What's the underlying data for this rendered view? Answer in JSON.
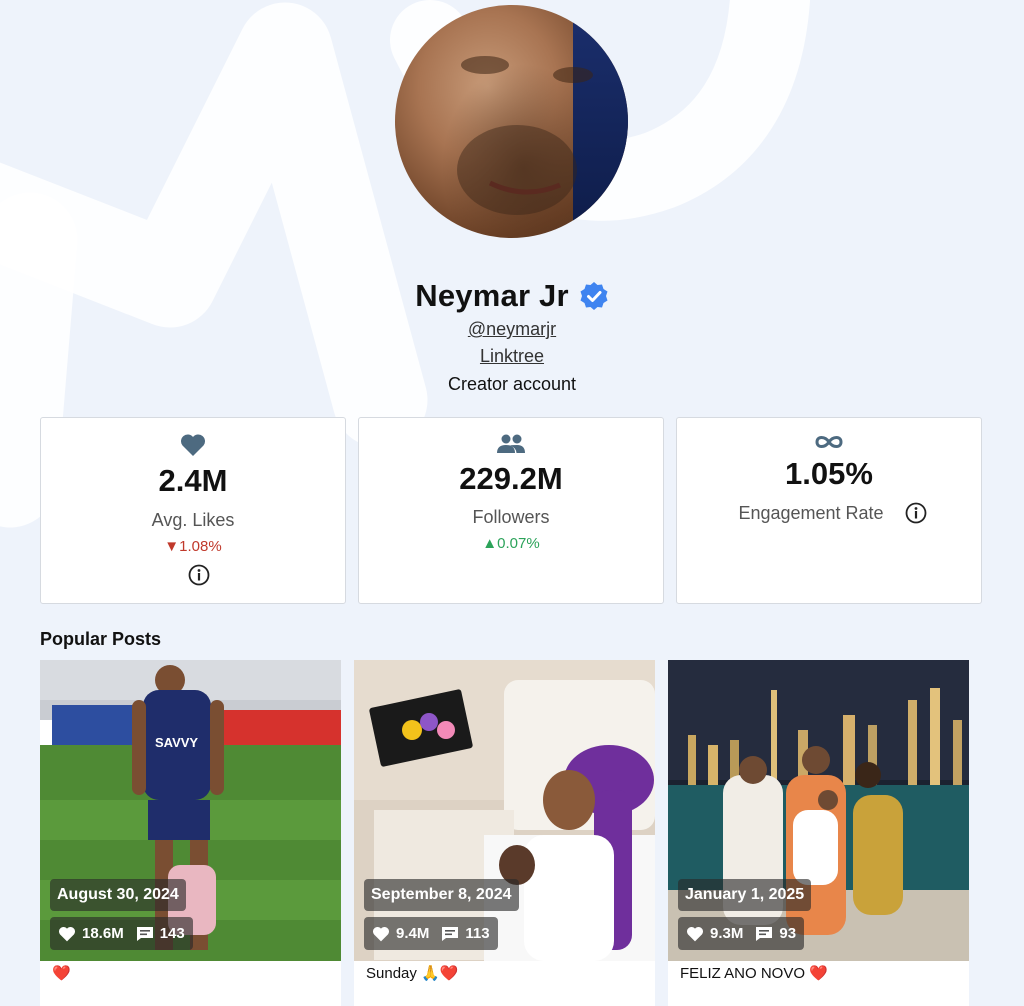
{
  "profile": {
    "name": "Neymar Jr",
    "handle": "@neymarjr",
    "link": "Linktree",
    "account_type": "Creator account",
    "verified": true
  },
  "stats": [
    {
      "icon": "heart-icon",
      "value": "2.4M",
      "label": "Avg. Likes",
      "change": "▼1.08%",
      "trend": "down"
    },
    {
      "icon": "people-icon",
      "value": "229.2M",
      "label": "Followers",
      "change": "▲0.07%",
      "trend": "up"
    },
    {
      "icon": "infinity-icon",
      "value": "1.05%",
      "label": "Engagement Rate"
    }
  ],
  "popular_posts": {
    "title": "Popular Posts",
    "posts": [
      {
        "date": "August 30, 2024",
        "likes": "18.6M",
        "comments": "143",
        "caption": "❤️"
      },
      {
        "date": "September 8, 2024",
        "likes": "9.4M",
        "comments": "113",
        "caption": "Sunday 🙏❤️"
      },
      {
        "date": "January 1, 2025",
        "likes": "9.3M",
        "comments": "93",
        "caption": "FELIZ ANO NOVO ❤️"
      }
    ]
  },
  "colors": {
    "background": "#eef3fb",
    "verified_badge": "#3f84f0",
    "icon_slate": "#4d6a80",
    "trend_down": "#c0392b",
    "trend_up": "#2ca35a"
  }
}
